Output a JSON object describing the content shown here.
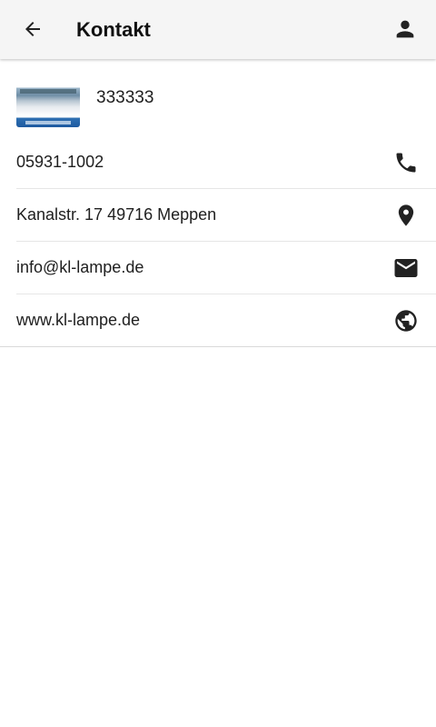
{
  "app_bar": {
    "title": "Kontakt",
    "back_icon": "arrow-back-icon",
    "account_icon": "person-icon"
  },
  "contact": {
    "name": "333333",
    "phone": "05931-1002",
    "address": "Kanalstr. 17 49716 Meppen",
    "email": "info@kl-lampe.de",
    "website": "www.kl-lampe.de"
  },
  "icons": {
    "phone": "phone-icon",
    "address": "location-pin-icon",
    "email": "mail-icon",
    "website": "globe-icon"
  },
  "colors": {
    "app_bar_bg": "#f5f5f5",
    "icon": "#222222",
    "divider": "#e6e6e6"
  }
}
